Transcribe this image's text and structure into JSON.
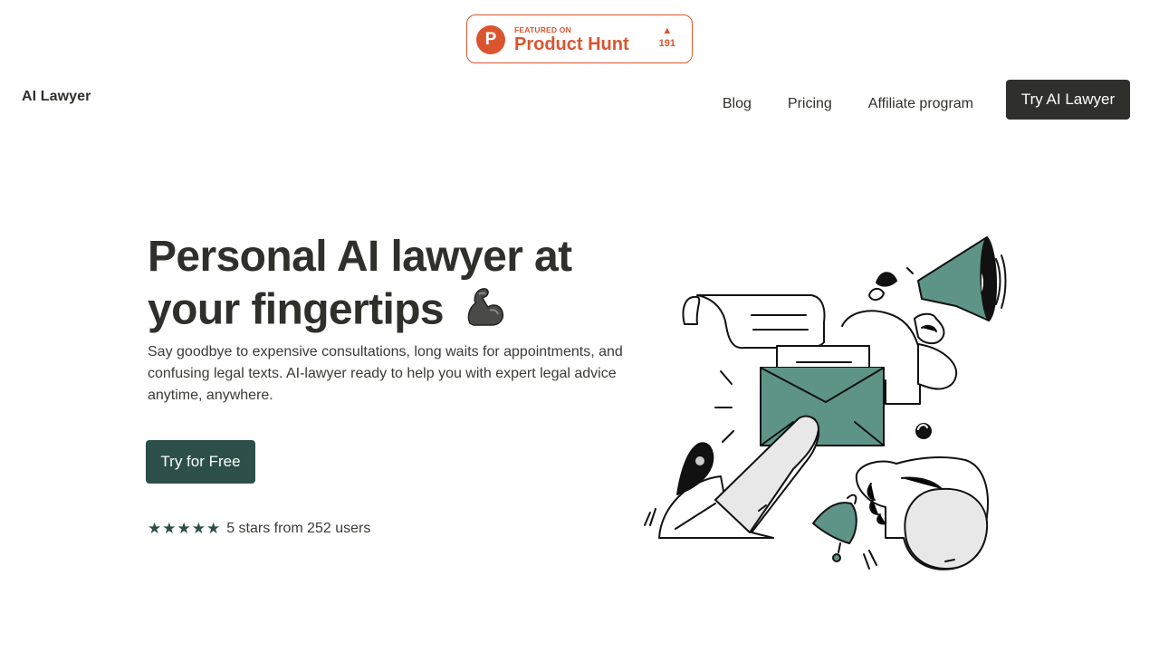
{
  "product_hunt": {
    "featured_label": "FEATURED ON",
    "name": "Product Hunt",
    "logo_letter": "P",
    "votes": "191",
    "upvote_icon": "triangle-up-icon"
  },
  "header": {
    "brand": "AI Lawyer",
    "nav": [
      "Blog",
      "Pricing",
      "Affiliate program"
    ],
    "cta": "Try AI Lawyer"
  },
  "hero": {
    "title_line1": "Personal AI lawyer at",
    "title_line2": "your fingertips",
    "emoji_icon": "flexed-biceps-icon",
    "subtitle": "Say goodbye to expensive consultations, long waits for appointments, and confusing legal texts. AI-lawyer ready to help you with expert legal advice anytime, anywhere.",
    "cta": "Try for Free",
    "stars": "★★★★★",
    "rating_text": "5 stars from 252 users"
  },
  "colors": {
    "accent": "#2c4f4a",
    "teal_fill": "#5e9488",
    "dark": "#2f2f2b",
    "product_hunt": "#da552f",
    "light_gray": "#e8e8e8"
  },
  "illustration": {
    "icon": "email-megaphone-illustration"
  }
}
